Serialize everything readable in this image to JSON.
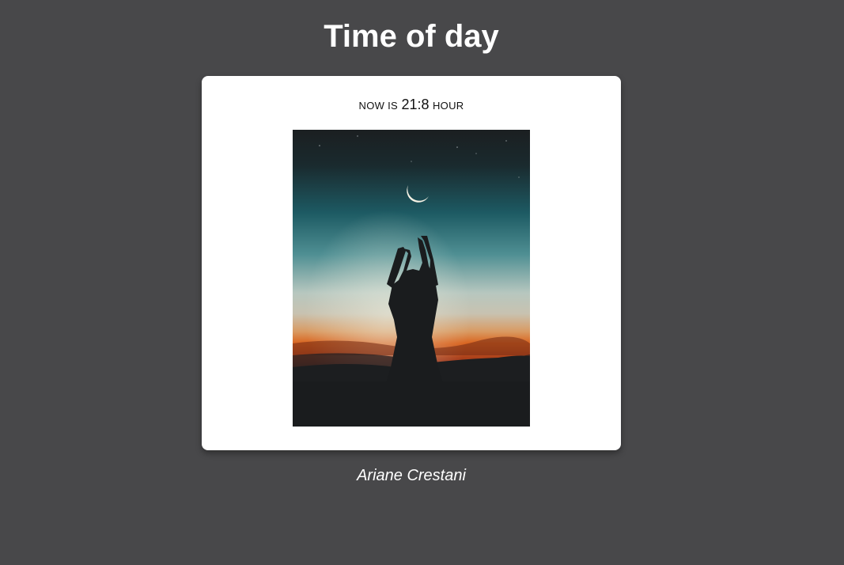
{
  "header": {
    "title": "Time of day"
  },
  "card": {
    "now_is_label": "NOW IS",
    "time_value": "21:8",
    "hour_label": "HOUR"
  },
  "photo": {
    "subject": "silhouette of person reaching toward crescent moon at dusk"
  },
  "footer": {
    "credit": "Ariane Crestani"
  },
  "colors": {
    "background": "#48484a",
    "card": "#ffffff",
    "title_text": "#ffffff"
  }
}
